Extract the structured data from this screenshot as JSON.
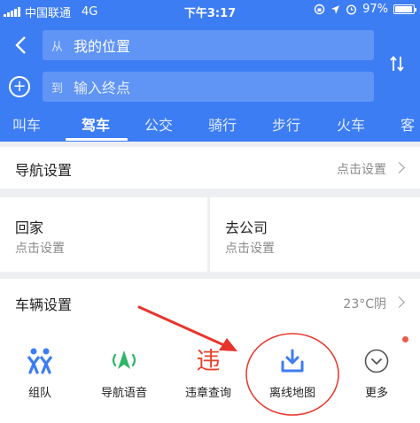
{
  "status": {
    "carrier": "中国联通",
    "network": "4G",
    "time": "下午3:17",
    "battery": "97%",
    "battery_level": 0.97
  },
  "route": {
    "from_prefix": "从",
    "from_value": "我的位置",
    "to_prefix": "到",
    "to_placeholder": "输入终点"
  },
  "tabs": [
    "叫车",
    "驾车",
    "公交",
    "骑行",
    "步行",
    "火车",
    "客"
  ],
  "active_tab": "驾车",
  "nav_settings": {
    "title": "导航设置",
    "action": "点击设置"
  },
  "home": {
    "title": "回家",
    "sub": "点击设置"
  },
  "company": {
    "title": "去公司",
    "sub": "点击设置"
  },
  "vehicle": {
    "title": "车辆设置",
    "weather": "23°C阴"
  },
  "toolbar": [
    {
      "label": "组队",
      "icon": "team-icon"
    },
    {
      "label": "导航语音",
      "icon": "voice-navigation-icon"
    },
    {
      "label": "违章查询",
      "icon": "violation-icon",
      "glyph": "违"
    },
    {
      "label": "离线地图",
      "icon": "download-icon"
    },
    {
      "label": "更多",
      "icon": "chevron-down-icon"
    }
  ],
  "colors": {
    "brand_blue": "#3d7df3",
    "violation_red": "#e8432f",
    "annotation_red": "#e8352b",
    "badge_red": "#f05a4a"
  }
}
